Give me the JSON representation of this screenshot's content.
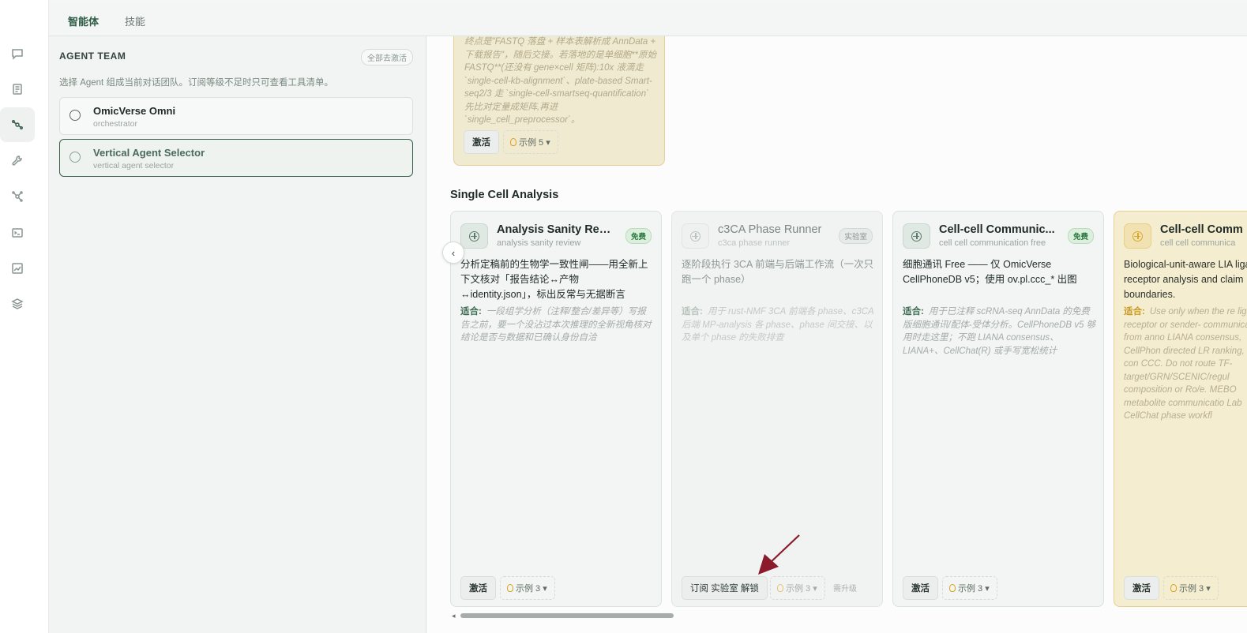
{
  "tabs": [
    {
      "label": "智能体",
      "active": true
    },
    {
      "label": "技能",
      "active": false
    }
  ],
  "rail_icons": [
    "chat-icon",
    "document-icon",
    "agents-icon",
    "wrench-icon",
    "network-icon",
    "terminal-icon",
    "chart-icon",
    "layers-icon"
  ],
  "panel": {
    "title": "AGENT TEAM",
    "deactivate_all": "全部去激活",
    "description": "选择 Agent 组成当前对话团队。订阅等级不足时只可查看工具清单。",
    "agents": [
      {
        "name": "OmicVerse Omni",
        "sub": "orchestrator",
        "selected": false
      },
      {
        "name": "Vertical Agent Selector",
        "sub": "vertical agent selector",
        "selected": true
      }
    ]
  },
  "top_card": {
    "text": "终点是\"FASTQ 落盘 + 样本表解析成 AnnData + 下载报告\"，随后交接。若落地的是单细胞**原始 FASTQ**(还没有 gene×cell 矩阵):10x 液滴走 `single-cell-kb-alignment`、plate-based Smart-seq2/3 走 `single-cell-smartseq-quantification` 先比对定量成矩阵,再进 `single_cell_preprocessor`。",
    "activate": "激活",
    "example": "示例 5"
  },
  "section_title": "Single Cell Analysis",
  "cards": [
    {
      "title": "Analysis Sanity Revi...",
      "sub": "analysis sanity review",
      "badge": "免费",
      "desc": "分析定稿前的生物学一致性闸——用全新上下文核对「报告结论↔产物↔identity.json」，标出反常与无据断言",
      "fit_label": "适合:",
      "fit": "一段组学分析（注释/整合/差异等）写报告之前，要一个没沾过本次推理的全新视角核对结论是否与数据和已确认身份自洽",
      "activate": "激活",
      "example": "示例 3"
    },
    {
      "title": "c3CA Phase Runner",
      "sub": "c3ca phase runner",
      "badge": "实验室",
      "desc": "逐阶段执行 3CA 前端与后端工作流（一次只跑一个 phase）",
      "fit_label": "适合:",
      "fit": "用于 rust-NMF 3CA 前端各 phase、c3CA 后端 MP-analysis 各 phase、phase 间交接、以及单个 phase 的失败排查",
      "subscribe": "订阅 实验室 解锁",
      "example": "示例 3",
      "upgrade": "需升级"
    },
    {
      "title": "Cell-cell Communic...",
      "sub": "cell cell communication free",
      "badge": "免费",
      "desc": "细胞通讯 Free —— 仅 OmicVerse CellPhoneDB v5；使用 ov.pl.ccc_* 出图",
      "fit_label": "适合:",
      "fit": "用于已注释 scRNA-seq AnnData 的免费版细胞通讯/配体-受体分析。CellPhoneDB v5 够用时走这里；不跑 LIANA consensus、LIANA+、CellChat(R) 或手写宽松统计",
      "activate": "激活",
      "example": "示例 3"
    },
    {
      "title": "Cell-cell Comm",
      "sub": "cell cell communica",
      "desc": "Biological-unit-aware LIA ligand-receptor analysis and claim boundaries.",
      "fit_label": "适合:",
      "fit": "Use only when the re ligand-receptor or sender- communication from anno LIANA consensus, CellPhon directed LR ranking, or con CCC. Do not route TF-target/GRN/SCENIC/regul composition or Ro/e. MEBO metabolite communicatio Lab CellChat phase workfl",
      "activate": "激活",
      "example": "示例 3"
    }
  ],
  "colors": {
    "accent": "#2f5d46",
    "free_badge": "#2e7a44",
    "amber": "#c99a21",
    "arrow": "#8b1a2b"
  }
}
